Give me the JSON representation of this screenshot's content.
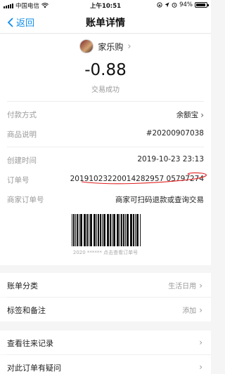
{
  "status_bar": {
    "carrier": "中国电信",
    "time": "上午10:51",
    "battery": "94%",
    "battery_level": 0.94
  },
  "nav": {
    "back_label": "返回",
    "title": "账单详情"
  },
  "merchant": {
    "name": "家乐购"
  },
  "amount": "-0.88",
  "status": "交易成功",
  "details": {
    "payment_method_label": "付款方式",
    "payment_method_value": "余额宝",
    "desc_label": "商品说明",
    "desc_value": "#20200907038",
    "created_label": "创建时间",
    "created_value": "2019-10-23 23:13",
    "order_label": "订单号",
    "order_value": "20191023220014282957 05797274",
    "merchant_order_label": "商家订单号",
    "merchant_order_value": "商家可扫码退款或查询交易"
  },
  "barcode_caption": "2020 ****** 点击查看订单号",
  "actions": {
    "category_label": "账单分类",
    "category_value": "生活日用",
    "tags_label": "标签和备注",
    "tags_value": "添加",
    "history_label": "查看往来记录",
    "dispute_label": "对此订单有疑问"
  },
  "colors": {
    "accent": "#108ee9",
    "annotation": "#e02020"
  }
}
